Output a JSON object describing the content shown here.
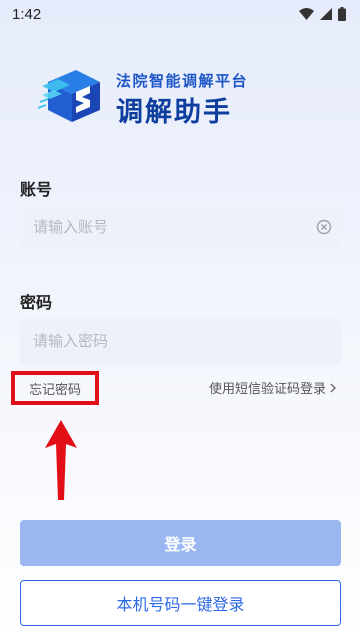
{
  "status_bar": {
    "time": "1:42",
    "icons": [
      "wifi-icon",
      "signal-icon",
      "battery-icon"
    ]
  },
  "logo": {
    "subtitle": "法院智能调解平台",
    "title": "调解助手"
  },
  "account": {
    "label": "账号",
    "placeholder": "请输入账号",
    "value": ""
  },
  "password": {
    "label": "密码",
    "placeholder": "请输入密码",
    "value": ""
  },
  "links": {
    "forgot_password": "忘记密码",
    "sms_login": "使用短信验证码登录"
  },
  "buttons": {
    "login": "登录",
    "one_key_login": "本机号码一键登录"
  },
  "colors": {
    "brand_blue": "#2e6ae6",
    "login_button_disabled": "#9ab7f2",
    "annotation_red": "#e20f17",
    "input_bg": "#eef1f8"
  }
}
